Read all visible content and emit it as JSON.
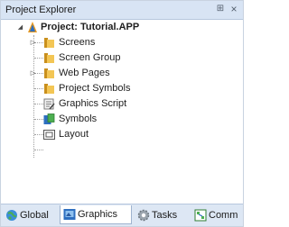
{
  "panel": {
    "title": "Project Explorer",
    "pin_glyph": "⊞",
    "close_glyph": "×"
  },
  "tree": {
    "root": {
      "label": "Project: Tutorial.APP",
      "icon": "project-icon",
      "expanded": true
    },
    "items": [
      {
        "label": "Screens",
        "icon": "folder-icon",
        "expandable": true
      },
      {
        "label": "Screen Group",
        "icon": "folder-icon",
        "expandable": false
      },
      {
        "label": "Web Pages",
        "icon": "folder-icon",
        "expandable": true
      },
      {
        "label": "Project Symbols",
        "icon": "folder-icon",
        "expandable": false
      },
      {
        "label": "Graphics Script",
        "icon": "script-icon",
        "expandable": false
      },
      {
        "label": "Symbols",
        "icon": "symbols-icon",
        "expandable": false
      },
      {
        "label": "Layout",
        "icon": "layout-icon",
        "expandable": false
      }
    ]
  },
  "tabs": [
    {
      "label": "Global",
      "icon": "globe-icon",
      "active": false
    },
    {
      "label": "Graphics",
      "icon": "graphics-icon",
      "active": true
    },
    {
      "label": "Tasks",
      "icon": "gear-icon",
      "active": false
    },
    {
      "label": "Comm",
      "icon": "comm-icon",
      "active": false
    }
  ],
  "colors": {
    "title_bar": "#d8e4f4",
    "tab_bar": "#dde7f4",
    "folder": "#e8b84a",
    "accent_blue": "#2e6fc0"
  }
}
